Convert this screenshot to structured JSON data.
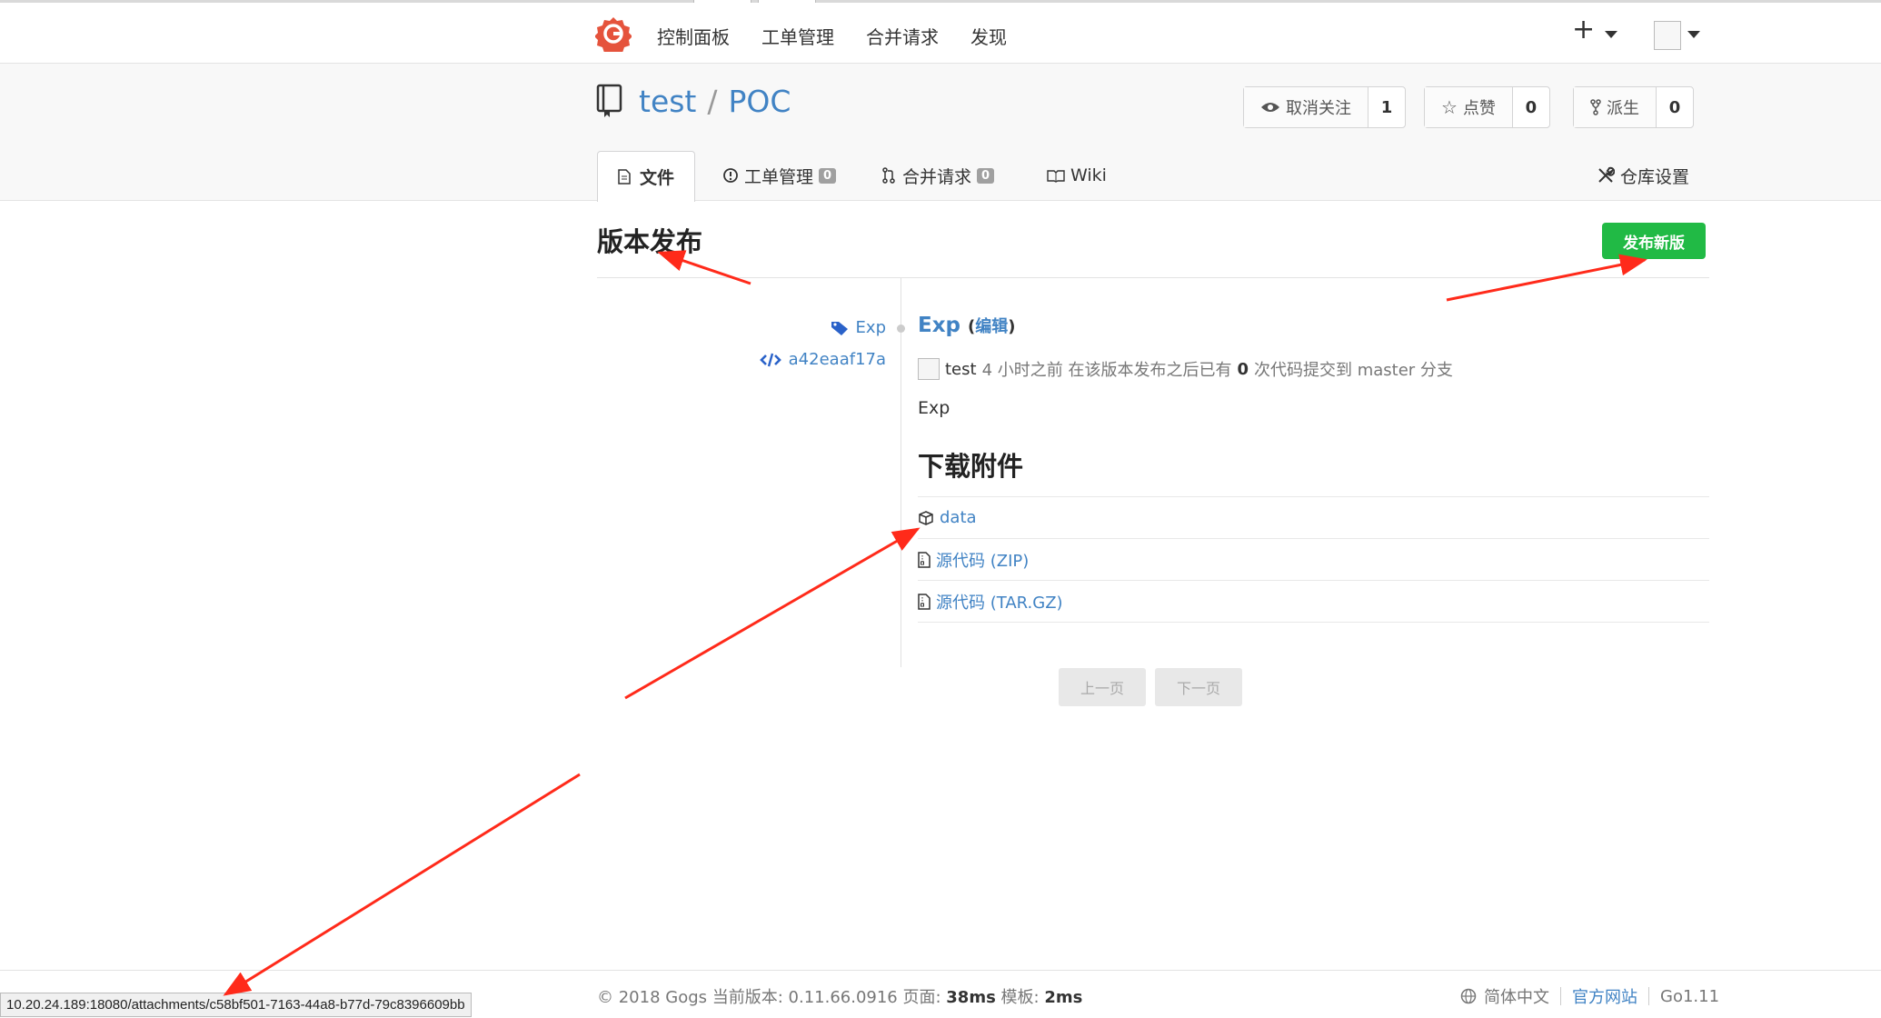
{
  "nav": {
    "items": [
      "控制面板",
      "工单管理",
      "合并请求",
      "发现"
    ],
    "plus": "+"
  },
  "repo": {
    "owner": "test",
    "separator": "/",
    "name": "POC",
    "watch": {
      "label": "取消关注",
      "count": "1"
    },
    "star": {
      "label": "点赞",
      "count": "0"
    },
    "fork": {
      "label": "派生",
      "count": "0"
    }
  },
  "tabs": {
    "files": "文件",
    "issues": {
      "label": "工单管理",
      "count": "0"
    },
    "pulls": {
      "label": "合并请求",
      "count": "0"
    },
    "wiki": "Wiki",
    "settings": "仓库设置"
  },
  "page": {
    "title": "版本发布",
    "new_release": "发布新版"
  },
  "release": {
    "tag": "Exp",
    "commit": "a42eaaf17a",
    "title": "Exp",
    "edit_open": "(",
    "edit": "编辑",
    "edit_close": ")",
    "author": "test",
    "time_text": "4 小时之前 在该版本发布之后已有",
    "commits_count": "0",
    "commits_text": "次代码提交到 master 分支",
    "body": "Exp"
  },
  "downloads": {
    "title": "下载附件",
    "items": [
      {
        "name": "data",
        "icon": "package-icon"
      },
      {
        "name": "源代码 (ZIP)",
        "icon": "file-zip-icon"
      },
      {
        "name": "源代码 (TAR.GZ)",
        "icon": "file-zip-icon"
      }
    ]
  },
  "pagination": {
    "prev": "上一页",
    "next": "下一页"
  },
  "footer": {
    "copyright": "© 2018 Gogs 当前版本: 0.11.66.0916 页面:",
    "page_time": "38ms",
    "tmpl_label": "模板:",
    "tmpl_time": "2ms",
    "language": "简体中文",
    "website": "官方网站",
    "go_version": "Go1.11"
  },
  "status_url": "10.20.24.189:18080/attachments/c58bf501-7163-44a8-b77d-79c8396609bb",
  "colors": {
    "accent": "#4183c4",
    "green": "#21ba45",
    "annotation": "#ff2a1a",
    "logo": "#e5533c"
  }
}
